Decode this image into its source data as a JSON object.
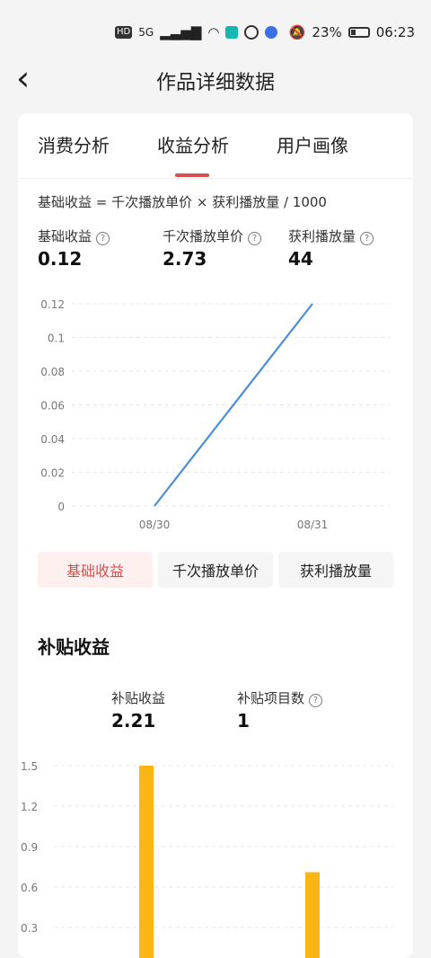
{
  "status": {
    "hd": "HD",
    "network": "5G",
    "battery": "23%",
    "time": "06:23"
  },
  "header": {
    "title": "作品详细数据"
  },
  "tabs": [
    {
      "label": "消费分析"
    },
    {
      "label": "收益分析"
    },
    {
      "label": "用户画像"
    }
  ],
  "basic": {
    "formula": "基础收益 = 千次播放单价 × 获利播放量 / 1000",
    "metrics": [
      {
        "label": "基础收益",
        "value": "0.12"
      },
      {
        "label": "千次播放单价",
        "value": "2.73"
      },
      {
        "label": "获利播放量",
        "value": "44"
      }
    ],
    "chart_data": {
      "type": "line",
      "x": [
        "08/30",
        "08/31"
      ],
      "series": [
        {
          "values": [
            0,
            0.12
          ]
        }
      ],
      "y_ticks": [
        "0.12",
        "0.1",
        "0.08",
        "0.06",
        "0.04",
        "0.02",
        "0"
      ],
      "ylim": [
        0,
        0.12
      ],
      "grid": true,
      "color": "#4a8fd6"
    },
    "buttons": [
      {
        "label": "基础收益"
      },
      {
        "label": "千次播放单价"
      },
      {
        "label": "获利播放量"
      }
    ]
  },
  "subsidy": {
    "title": "补贴收益",
    "metrics": [
      {
        "label": "补贴收益",
        "value": "2.21"
      },
      {
        "label": "补贴项目数",
        "value": "1"
      }
    ],
    "chart_data": {
      "type": "bar",
      "categories": [
        "",
        ""
      ],
      "values": [
        1.5,
        0.71
      ],
      "y_ticks": [
        "1.5",
        "1.2",
        "0.9",
        "0.6",
        "0.3"
      ],
      "ylim": [
        0,
        1.5
      ],
      "grid": true,
      "color": "#fbb515"
    }
  }
}
